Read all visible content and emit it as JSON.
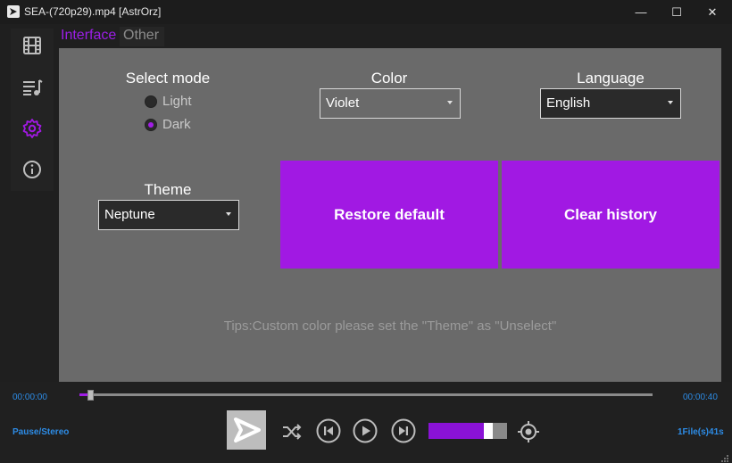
{
  "window": {
    "title": "SEA-(720p29).mp4 [AstrOrz]",
    "minimize_glyph": "—",
    "maximize_glyph": "☐",
    "close_glyph": "✕"
  },
  "sidebar": {
    "items": [
      {
        "icon": "film-icon"
      },
      {
        "icon": "playlist-icon"
      },
      {
        "icon": "gear-icon",
        "active": true
      },
      {
        "icon": "info-icon"
      }
    ]
  },
  "tabs": [
    "Interface",
    "Other"
  ],
  "settings": {
    "select_mode": {
      "label": "Select mode",
      "options": [
        "Light",
        "Dark"
      ],
      "selected": "Dark"
    },
    "color": {
      "label": "Color",
      "value": "Violet"
    },
    "language": {
      "label": "Language",
      "value": "English"
    },
    "theme": {
      "label": "Theme",
      "value": "Neptune"
    },
    "restore_default_label": "Restore default",
    "clear_history_label": "Clear history",
    "tips": "Tips:Custom color please set the \"Theme\" as \"Unselect\""
  },
  "player": {
    "current_time": "00:00:00",
    "total_time": "00:00:40",
    "seek_progress": 0.02,
    "status": "Pause/Stereo",
    "file_info": "1File(s)41s",
    "volume": 0.72
  },
  "colors": {
    "accent": "#a119e3",
    "time_text": "#2d8ce6",
    "panel_bg": "#6a6a6a"
  }
}
